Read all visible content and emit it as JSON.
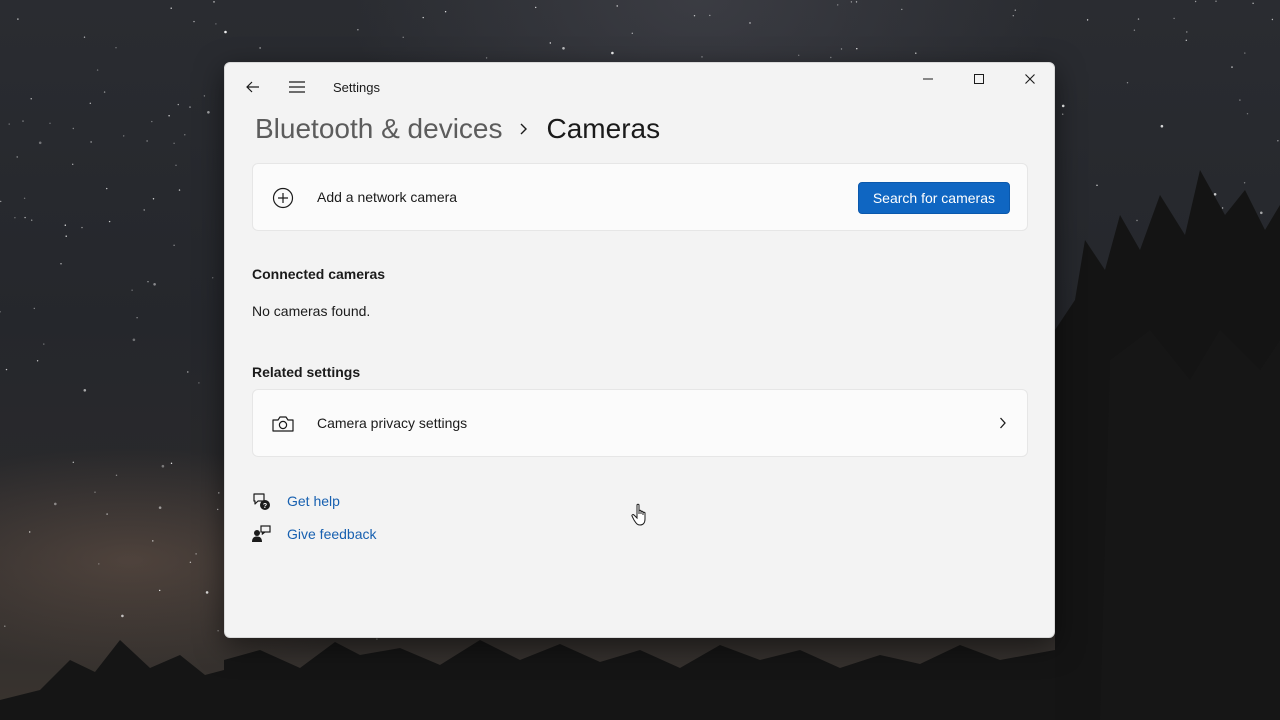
{
  "window": {
    "title": "Settings"
  },
  "breadcrumb": {
    "parent": "Bluetooth & devices",
    "current": "Cameras"
  },
  "add_camera": {
    "label": "Add a network camera",
    "button_label": "Search for cameras",
    "icon": "add-circle-icon"
  },
  "connected_cameras": {
    "heading": "Connected cameras",
    "empty_text": "No cameras found."
  },
  "related_settings": {
    "heading": "Related settings",
    "items": [
      {
        "label": "Camera privacy settings",
        "icon": "camera-icon"
      }
    ]
  },
  "help_links": [
    {
      "label": "Get help",
      "icon": "help-chat-icon"
    },
    {
      "label": "Give feedback",
      "icon": "feedback-icon"
    }
  ],
  "colors": {
    "accent": "#0f66c2",
    "link": "#1760b0",
    "window_bg": "#f3f3f3",
    "card_bg": "#fbfbfb"
  }
}
